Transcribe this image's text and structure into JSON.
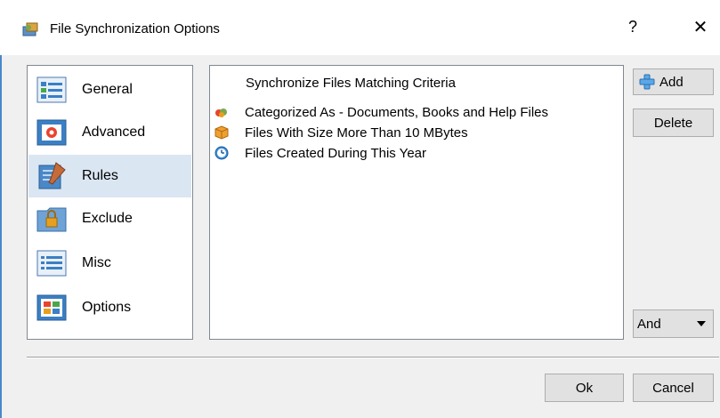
{
  "window": {
    "title": "File Synchronization Options",
    "help_label": "?",
    "close_label": "✕"
  },
  "nav": {
    "items": [
      {
        "label": "General",
        "icon": "general-icon"
      },
      {
        "label": "Advanced",
        "icon": "advanced-icon"
      },
      {
        "label": "Rules",
        "icon": "rules-icon",
        "selected": true
      },
      {
        "label": "Exclude",
        "icon": "exclude-icon"
      },
      {
        "label": "Misc",
        "icon": "misc-icon"
      },
      {
        "label": "Options",
        "icon": "options-icon"
      }
    ]
  },
  "rules": {
    "header": "Synchronize Files Matching Criteria",
    "items": [
      {
        "label": "Categorized As - Documents, Books and Help Files",
        "icon": "category-icon"
      },
      {
        "label": "Files With Size More Than 10 MBytes",
        "icon": "size-icon"
      },
      {
        "label": "Files Created During This Year",
        "icon": "clock-icon"
      }
    ]
  },
  "buttons": {
    "add": "Add",
    "delete": "Delete",
    "combine": "And",
    "ok": "Ok",
    "cancel": "Cancel"
  },
  "colors": {
    "accent": "#4a88c8",
    "selection": "#dbe6f3"
  }
}
